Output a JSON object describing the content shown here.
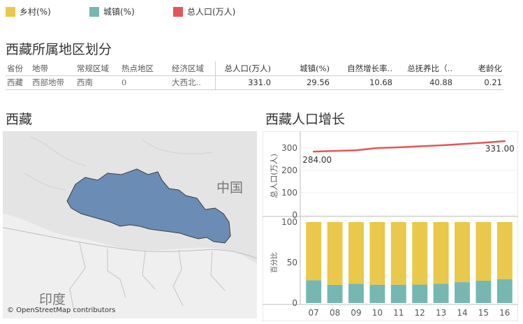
{
  "legend": [
    {
      "label": "乡村(%)",
      "color": "#e9c84b"
    },
    {
      "label": "城镇(%)",
      "color": "#76b7b2"
    },
    {
      "label": "总人口(万人)",
      "color": "#e15759"
    }
  ],
  "summary": {
    "title": "西藏所属地区划分",
    "columns": [
      "省份",
      "地带",
      "常规区域",
      "热点地区",
      "经济区域",
      "总人口(万人)",
      "城镇(%)",
      "自然增长率..",
      "总抚养比（..",
      "老龄化"
    ],
    "row": [
      "西藏",
      "西部地带",
      "西南",
      "0",
      "大西北..",
      "331.0",
      "29.56",
      "10.68",
      "40.88",
      "0.21"
    ]
  },
  "map": {
    "title": "西藏",
    "label_china": "中国",
    "label_india": "印度",
    "attribution": "© OpenStreetMap contributors",
    "region_color": "#6b8cb5"
  },
  "growth": {
    "title": "西藏人口增长"
  },
  "chart_data": [
    {
      "type": "line",
      "ylabel": "总人口(万人)",
      "x": [
        "07",
        "08",
        "09",
        "10",
        "11",
        "12",
        "13",
        "14",
        "15",
        "16"
      ],
      "series": [
        {
          "name": "总人口(万人)",
          "color": "#e15759",
          "values": [
            284.0,
            287.0,
            290.0,
            300.0,
            303.0,
            308.0,
            312.0,
            318.0,
            324.0,
            331.0
          ]
        }
      ],
      "ylim": [
        0,
        350
      ],
      "yticks": [
        0,
        100,
        200,
        300
      ],
      "annotations": [
        "284.00",
        "331.00"
      ]
    },
    {
      "type": "bar",
      "ylabel": "百分比",
      "categories": [
        "07",
        "08",
        "09",
        "10",
        "11",
        "12",
        "13",
        "14",
        "15",
        "16"
      ],
      "stacked": true,
      "series": [
        {
          "name": "城镇(%)",
          "color": "#76b7b2",
          "values": [
            28.2,
            22.6,
            23.8,
            22.7,
            22.7,
            22.8,
            23.7,
            25.8,
            27.7,
            29.6
          ]
        },
        {
          "name": "乡村(%)",
          "color": "#e9c84b",
          "values": [
            71.8,
            77.4,
            76.2,
            77.3,
            77.3,
            77.2,
            76.3,
            74.2,
            72.3,
            70.4
          ]
        }
      ],
      "ylim": [
        0,
        100
      ],
      "yticks": [
        0,
        50,
        100
      ]
    }
  ]
}
